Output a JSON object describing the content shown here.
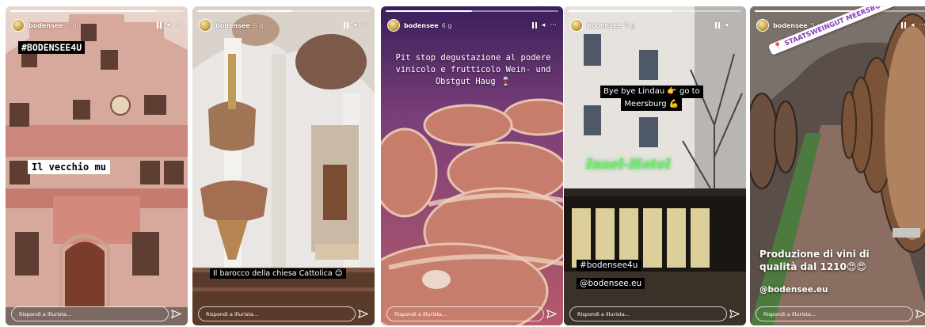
{
  "stories": [
    {
      "username": "bodensee",
      "time_ago": "6 g",
      "progress": 0.85,
      "hashtag": "#BODENSEE4U",
      "caption": "Il vecchio mu",
      "reply_placeholder": "Rispondi a illurista..."
    },
    {
      "username": "bodensee",
      "time_ago": "6 g",
      "progress": 0.55,
      "caption": "Il barocco della chiesa Cattolica",
      "caption_emoji": "😊",
      "reply_placeholder": "Rispondi a illurista..."
    },
    {
      "username": "bodensee",
      "time_ago": "6 g",
      "progress": 0.5,
      "caption_lines": [
        "Pit stop degustazione al podere",
        "vinicolo e frutticolo Wein- und",
        "Obstgut Haug 🍷"
      ],
      "reply_placeholder": "Rispondi a illurista..."
    },
    {
      "username": "bodensee",
      "time_ago": "5 g",
      "progress": 0.6,
      "caption_lines": [
        "Bye bye Lindau 👉 go to",
        "Meersburg 💪"
      ],
      "sign_text": "Insel-Hotel",
      "hashtag": "#bodensee4u",
      "mention": "@bodensee.eu",
      "reply_placeholder": "Rispondi a illurista..."
    },
    {
      "username": "bodensee",
      "time_ago": "5 g",
      "progress": 0.6,
      "location_sticker": "STAATSWEINGUT MEERSBURG",
      "caption_lines": [
        "Produzione di vini di",
        "qualità dal 1210😍😍"
      ],
      "mention": "@bodensee.eu",
      "reply_placeholder": "Rispondi a illurista..."
    }
  ],
  "icons": {
    "pause": "pause-icon",
    "volume": "volume-icon",
    "more": "more-icon",
    "send": "send-icon",
    "location": "location-pin-icon"
  },
  "colors": {
    "story_text": "#ffffff",
    "sticker_purple": "#8a3ab9"
  }
}
